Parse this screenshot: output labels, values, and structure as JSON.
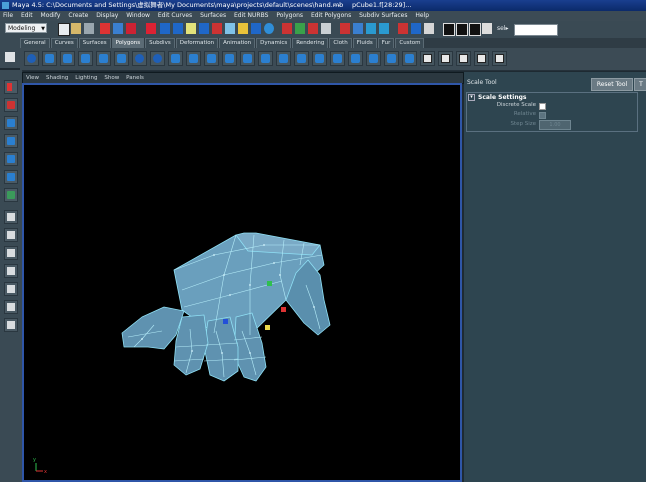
{
  "window": {
    "title_path": "Maya 4.5: C:\\Documents and Settings\\虚拟舞者\\My Documents\\maya\\projects\\default\\scenes\\hand.mb",
    "title_sep": "---",
    "title_object": "pCube1.f[28:29]..."
  },
  "menubar": [
    "File",
    "Edit",
    "Modify",
    "Create",
    "Display",
    "Window",
    "Edit Curves",
    "Surfaces",
    "Edit NURBS",
    "Polygons",
    "Edit Polygons",
    "Subdiv Surfaces",
    "Help"
  ],
  "statusline": {
    "mode": "Modeling",
    "sel_label": "sel▸"
  },
  "shelf": {
    "tabs": [
      "General",
      "Curves",
      "Surfaces",
      "Polygons",
      "Subdivs",
      "Deformation",
      "Animation",
      "Dynamics",
      "Rendering",
      "Cloth",
      "Fluids",
      "Fur",
      "Custom"
    ],
    "active_tab": "Polygons"
  },
  "viewport": {
    "menu": [
      "View",
      "Shading",
      "Lighting",
      "Show",
      "Panels"
    ],
    "axis_x": "x",
    "axis_y": "y",
    "colors": {
      "mesh_fill": "#5f92b0",
      "wire": "#8fe0f5",
      "selected_faces": "#c9e6f0",
      "background": "#000000"
    }
  },
  "tool_settings": {
    "title": "Scale Tool",
    "reset_label": "Reset Tool",
    "tab_stub": "T",
    "section": "Scale Settings",
    "discrete_label": "Discrete Scale",
    "relative_label": "Relative",
    "step_label": "Step Size",
    "step_value": "1.00"
  }
}
